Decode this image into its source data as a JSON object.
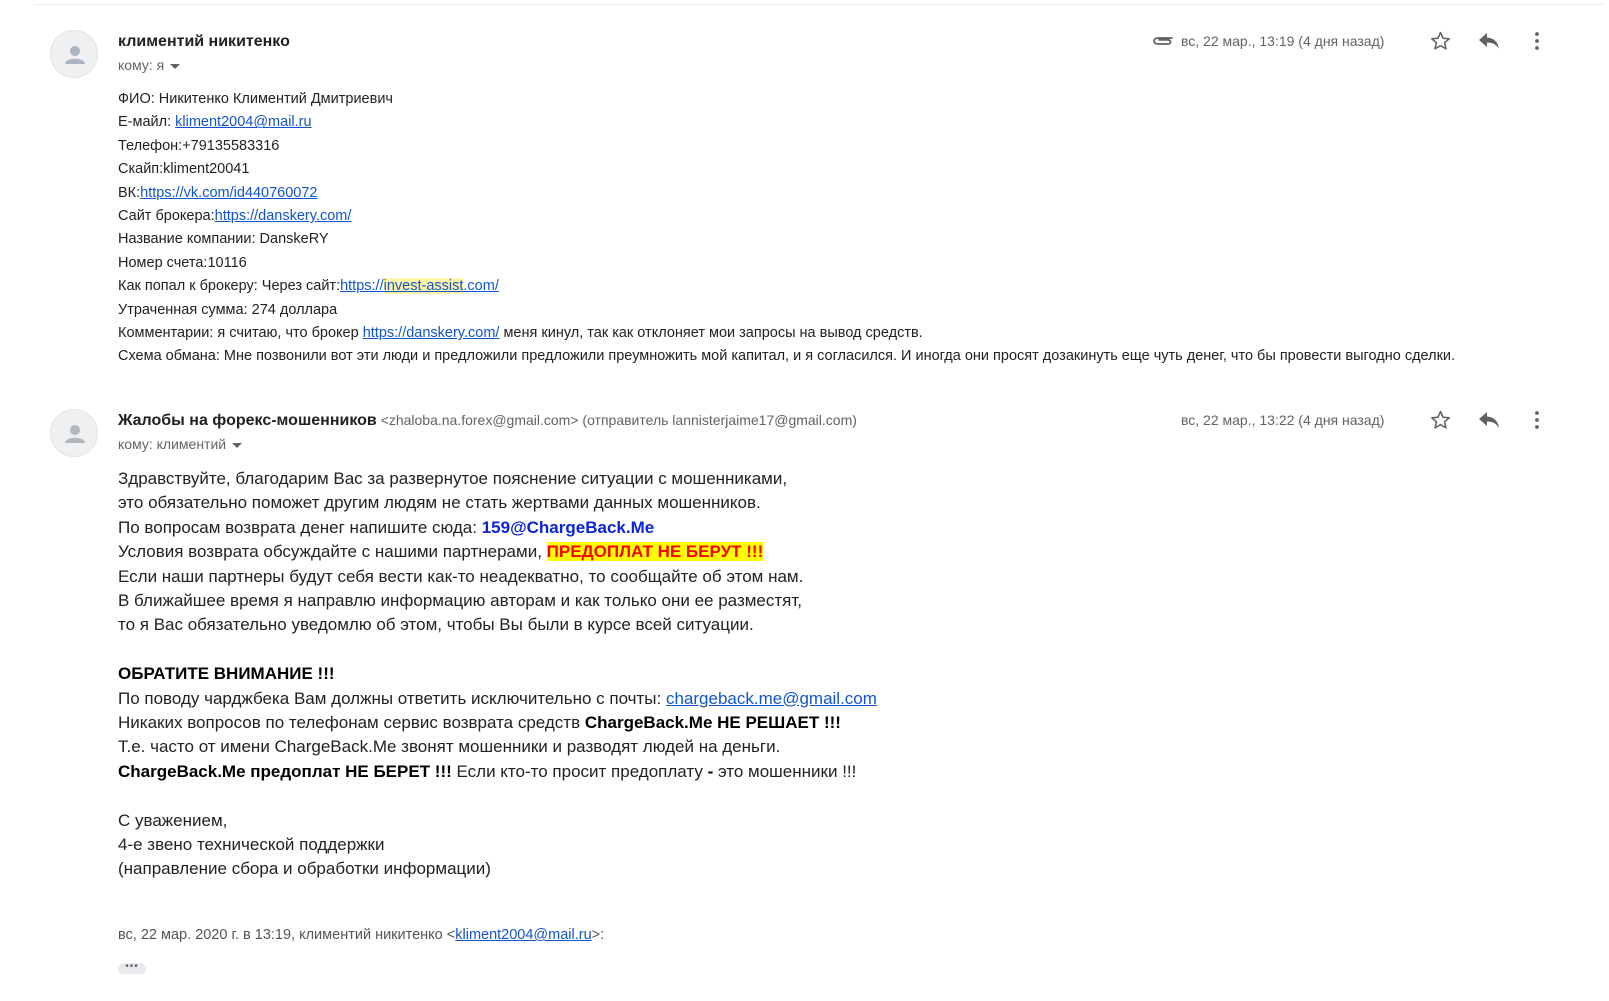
{
  "message1": {
    "sender_name": "климентий никитенко",
    "to_label": "кому: я",
    "date": "вс, 22 мар., 13:19 (4 дня назад)",
    "lines": {
      "fio": "ФИО: Никитенко Климентий Дмитриевич",
      "email_label": "E-майл: ",
      "email_link": "kliment2004@mail.ru",
      "phone": "Телефон:+79135583316",
      "skype": "Скайп:kliment20041",
      "vk_label": "ВК:",
      "vk_link": "https://vk.com/id440760072",
      "broker_site_label": "Сайт брокера:",
      "broker_site_link": "https://danskery.com/",
      "company": "Название компании: DanskeRY",
      "account": "Номер счета:10116",
      "how_label": "Как попал к брокеру: Через сайт:",
      "how_link_a": "https://",
      "how_link_b": "invest-assist",
      "how_link_c": ".com/",
      "lost": "Утраченная сумма: 274 доллара",
      "comment_a": "Комментарии: я считаю, что брокер ",
      "comment_link": "https://danskery.com/",
      "comment_b": " меня кинул, так как отклоняет мои запросы на вывод средств.",
      "scheme": "Схема обмана: Мне позвонили вот эти люди и предложили предложили преумножить мой капитал, и я согласился. И иногда они просят дозакинуть еще чуть денег, что бы провести выгодно сделки."
    }
  },
  "message2": {
    "sender_name": "Жалобы на форекс-мошенников",
    "sender_addr": " <zhaloba.na.forex@gmail.com> (отправитель lannisterjaime17@gmail.com)",
    "to_label": "кому: климентий",
    "date": "вс, 22 мар., 13:22 (4 дня назад)",
    "lines": {
      "l1": "Здравствуйте, благодарим Вас за развернутое пояснение ситуации с мошенниками,",
      "l2": "это обязательно поможет другим людям не стать жертвами данных мошенников.",
      "l3a": "По вопросам возврата денег напишите сюда: ",
      "l3b": "159@ChargeBack.Me",
      "l4a": "Условия возврата обсуждайте с нашими партнерами, ",
      "l4b": "ПРЕДОПЛАТ НЕ БЕРУТ !!!",
      "l5": "Если наши партнеры будут себя вести как-то неадекватно, то сообщайте об этом нам.",
      "l6": "В ближайшее время я направлю информацию авторам и как только они ее разместят,",
      "l7": "то я Вас обязательно уведомлю об этом, чтобы Вы были в курсе всей ситуации.",
      "attention": "ОБРАТИТЕ ВНИМАНИЕ !!!",
      "l8a": "По поводу чарджбека Вам должны ответить исключительно с почты: ",
      "l8b": "chargeback.me@gmail.com",
      "l9a": "Никаких вопросов по телефонам сервис возврата средств ",
      "l9b": "ChargeBack.Me НЕ РЕШАЕТ !!!",
      "l10": "Т.е. часто от имени ChargeBack.Me звонят мошенники и разводят людей на деньги.",
      "l11a": "ChargeBack.Me предоплат НЕ БЕРЕТ !!!",
      "l11b": " Если кто-то просит предоплату ",
      "l11c": "-",
      "l11d": " это мошенники !!!",
      "sig1": "С уважением,",
      "sig2": "4-е звено технической поддержки",
      "sig3": "(направление сбора и обработки информации)"
    },
    "quote_a": "вс, 22 мар. 2020 г. в 13:19, климентий никитенко <",
    "quote_link": "kliment2004@mail.ru",
    "quote_b": ">:",
    "dots": "•••"
  },
  "icons": {
    "attachment": "paperclip-icon",
    "star": "star-icon",
    "reply": "reply-icon",
    "more": "more-vert-icon",
    "avatar": "person-icon"
  },
  "colors": {
    "link": "#1155cc",
    "highlight_yellow": "#ffff00",
    "warning_red": "#ff0000",
    "address_blue": "#0b24d6"
  }
}
